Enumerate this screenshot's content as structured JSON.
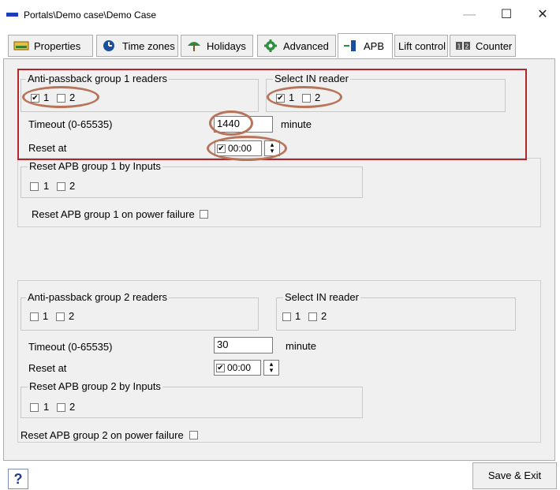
{
  "window": {
    "title": "Portals\\Demo case\\Demo Case",
    "minimize": "—",
    "maximize": "☐",
    "close": "✕"
  },
  "tabs": [
    {
      "label": "Properties",
      "icon": "properties-icon"
    },
    {
      "label": "Time zones",
      "icon": "clock-icon"
    },
    {
      "label": "Holidays",
      "icon": "beach-umbrella-icon"
    },
    {
      "label": "Advanced",
      "icon": "gear-icon"
    },
    {
      "label": "APB",
      "icon": "door-arrow-icon",
      "active": true
    },
    {
      "label": "Lift control",
      "icon": ""
    },
    {
      "label": "Counter",
      "icon": "counter-icon"
    }
  ],
  "group1": {
    "readers_title": "Anti-passback group 1 readers",
    "readers": [
      {
        "label": "1",
        "checked": true
      },
      {
        "label": "2",
        "checked": false
      }
    ],
    "in_title": "Select IN reader",
    "in_readers": [
      {
        "label": "1",
        "checked": true
      },
      {
        "label": "2",
        "checked": false
      }
    ],
    "timeout_label": "Timeout (0-65535)",
    "timeout_value": "1440",
    "timeout_unit": "minute",
    "reset_label": "Reset at",
    "reset_checked": true,
    "reset_time": "00:00",
    "inputs_title": "Reset APB group 1 by Inputs",
    "inputs": [
      {
        "label": "1",
        "checked": false
      },
      {
        "label": "2",
        "checked": false
      }
    ],
    "power_label": "Reset APB group 1 on power failure",
    "power_checked": false
  },
  "group2": {
    "readers_title": "Anti-passback group  2 readers",
    "readers": [
      {
        "label": "1",
        "checked": false
      },
      {
        "label": "2",
        "checked": false
      }
    ],
    "in_title": "Select IN reader",
    "in_readers": [
      {
        "label": "1",
        "checked": false
      },
      {
        "label": "2",
        "checked": false
      }
    ],
    "timeout_label": "Timeout (0-65535)",
    "timeout_value": "30",
    "timeout_unit": "minute",
    "reset_label": "Reset at",
    "reset_checked": true,
    "reset_time": "00:00",
    "inputs_title": "Reset APB group 2 by Inputs",
    "inputs": [
      {
        "label": "1",
        "checked": false
      },
      {
        "label": "2",
        "checked": false
      }
    ],
    "power_label": "Reset APB group 2 on power failure",
    "power_checked": false
  },
  "footer": {
    "help": "?",
    "save": "Save & Exit"
  },
  "colors": {
    "highlight_box": "#b3262b",
    "highlight_ellipse": "#b8745a",
    "panel_bg": "#f0f0f0"
  }
}
